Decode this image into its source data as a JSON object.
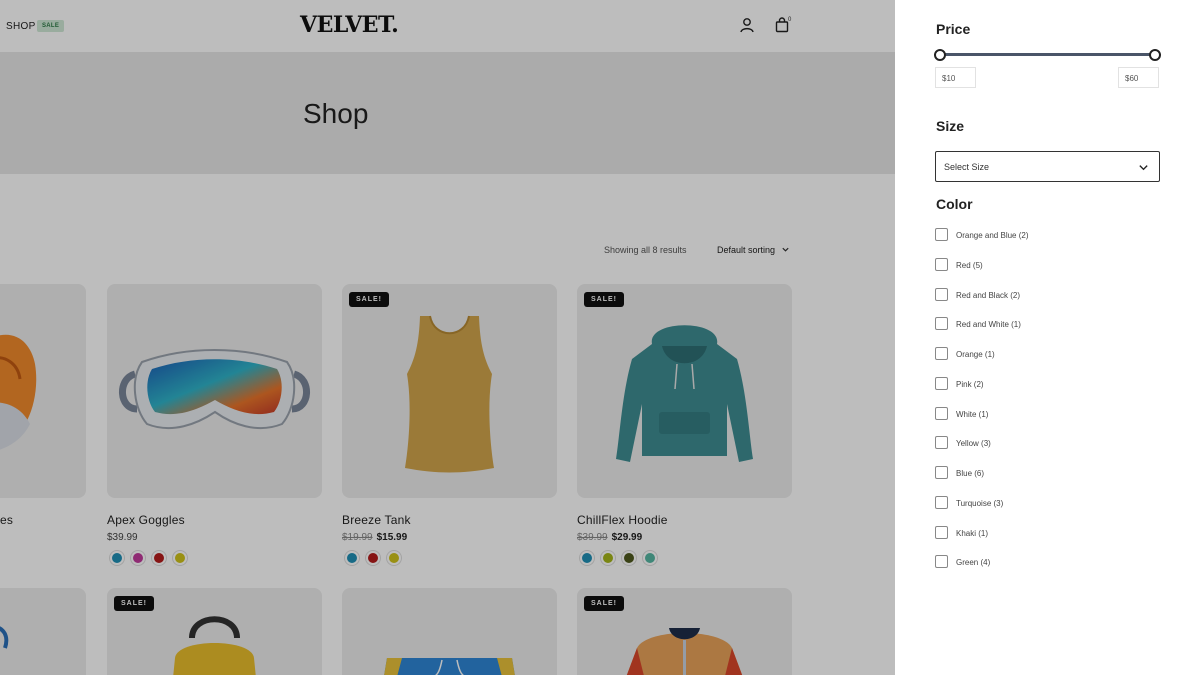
{
  "header": {
    "nav_shop": "SHOP",
    "sale_tag": "SALE",
    "logo": "VELVET.",
    "cart_count": "0",
    "icons": [
      "user-icon",
      "cart-icon"
    ]
  },
  "hero": {
    "title": "Shop"
  },
  "toolbar": {
    "result_count": "Showing all 8 results",
    "sorting": "Default sorting"
  },
  "products": [
    {
      "name": "es",
      "image": "sneaker-image"
    },
    {
      "name": "Apex Goggles",
      "price": "$39.99",
      "image": "goggles-image",
      "swatches": [
        "#1f8fb5",
        "#c23b9c",
        "#b51b1b",
        "#cfc31a"
      ]
    },
    {
      "name": "Breeze Tank",
      "old_price": "$19.99",
      "price": "$15.99",
      "badge": "SALE!",
      "image": "tank-top-image",
      "swatches": [
        "#1f8fb5",
        "#b51b1b",
        "#cfc31a"
      ]
    },
    {
      "name": "ChillFlex Hoodie",
      "old_price": "$39.99",
      "price": "$29.99",
      "badge": "SALE!",
      "image": "hoodie-image",
      "swatches": [
        "#1f8fb5",
        "#a5b51a",
        "#4f5a1e",
        "#56b6a3"
      ]
    }
  ],
  "second_row": [
    {
      "badge": "SALE!",
      "image": "backpack-image"
    },
    {
      "image": "shorts-image"
    },
    {
      "badge": "SALE!",
      "image": "jacket-image"
    }
  ],
  "filters": {
    "price": {
      "title": "Price",
      "min_label": "$10",
      "max_label": "$60",
      "range": [
        10,
        60
      ]
    },
    "size": {
      "title": "Size",
      "placeholder": "Select Size"
    },
    "color": {
      "title": "Color",
      "options": [
        "Orange and Blue (2)",
        "Red (5)",
        "Red and Black (2)",
        "Red and White (1)",
        "Orange (1)",
        "Pink (2)",
        "White (1)",
        "Yellow (3)",
        "Blue (6)",
        "Turquoise (3)",
        "Khaki (1)",
        "Green (4)"
      ]
    }
  },
  "colors": {
    "overlay": "rgba(0,0,0,0.26)",
    "badge": "#111111",
    "sale_tag_bg": "#cfe8d6"
  }
}
